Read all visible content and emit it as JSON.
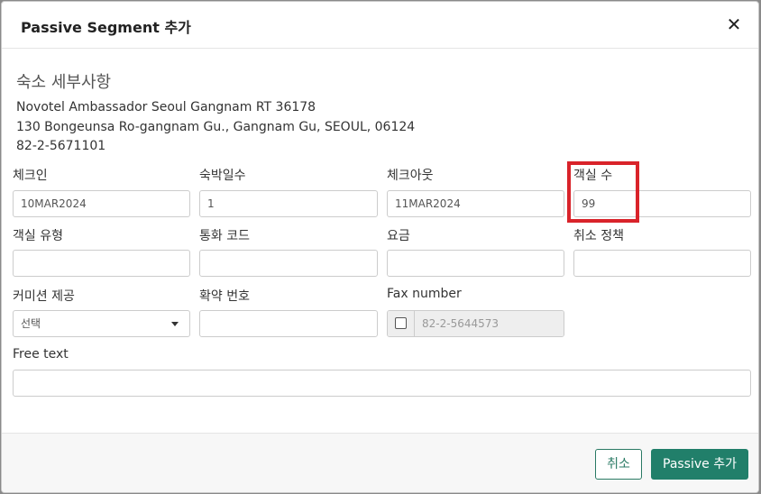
{
  "dialog": {
    "title": "Passive Segment 추가",
    "close_glyph": "✕"
  },
  "section": {
    "title": "숙소 세부사항"
  },
  "hotel": {
    "name": "Novotel Ambassador Seoul Gangnam RT 36178",
    "address": "130 Bongeunsa Ro-gangnam Gu., Gangnam Gu, SEOUL, 06124",
    "phone": "82-2-5671101"
  },
  "fields": {
    "checkin": {
      "label": "체크인",
      "value": "10MAR2024"
    },
    "nights": {
      "label": "숙박일수",
      "value": "1"
    },
    "checkout": {
      "label": "체크아웃",
      "value": "11MAR2024"
    },
    "rooms": {
      "label": "객실 수",
      "value": "99"
    },
    "room_type": {
      "label": "객실 유형",
      "value": ""
    },
    "currency": {
      "label": "통화 코드",
      "value": ""
    },
    "rate": {
      "label": "요금",
      "value": ""
    },
    "cancel_policy": {
      "label": "취소 정책",
      "value": ""
    },
    "commission": {
      "label": "커미션 제공",
      "value": "선택"
    },
    "confirmation": {
      "label": "확약 번호",
      "value": ""
    },
    "fax": {
      "label": "Fax number",
      "value": "82-2-5644573",
      "checked": false
    },
    "free_text": {
      "label": "Free text",
      "value": ""
    }
  },
  "footer": {
    "cancel_label": "취소",
    "add_label": "Passive 추가"
  },
  "colors": {
    "primary": "#217f6a",
    "highlight": "#d9232a"
  },
  "icons": {
    "close": "close-icon",
    "dropdown": "chevron-down-icon"
  }
}
